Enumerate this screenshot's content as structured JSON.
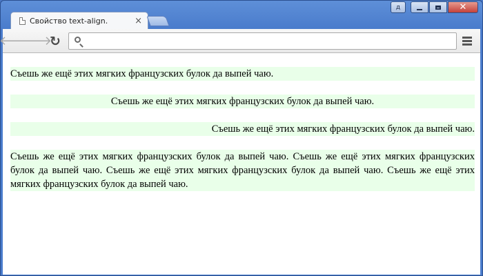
{
  "window": {
    "user_label": "д",
    "min_label": "minimize",
    "max_label": "maximize",
    "close_label": "close"
  },
  "tab": {
    "title": "Свойство text-align.",
    "close": "×"
  },
  "toolbar": {
    "back_icon": "arrow-left-icon",
    "forward_icon": "arrow-right-icon",
    "reload_icon": "reload-icon",
    "menu_icon": "hamburger-menu-icon",
    "address_value": ""
  },
  "content": {
    "p_left": "Съешь же ещё этих мягких французских булок да выпей чаю.",
    "p_center": "Съешь же ещё этих мягких французских булок да выпей чаю.",
    "p_right": "Съешь же ещё этих мягких французских булок да выпей чаю.",
    "p_justify": "Съешь же ещё этих мягких французских булок да выпей чаю. Съешь же ещё этих мягких французских булок да выпей чаю. Съешь же ещё этих мягких французских булок да выпей чаю. Съешь же ещё этих мягких французских булок да выпей чаю."
  },
  "colors": {
    "paragraph_background": "#e9ffe9",
    "window_frame": "#4a7ccc"
  }
}
